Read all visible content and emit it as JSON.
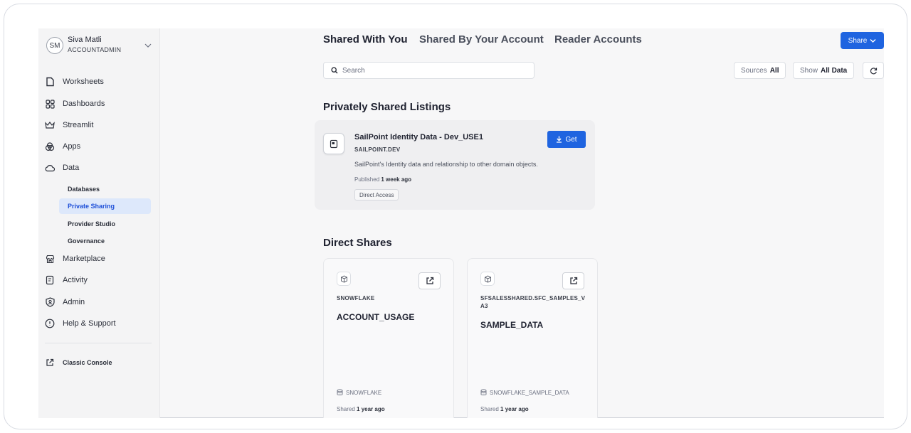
{
  "user": {
    "initials": "SM",
    "name": "Siva Matli",
    "role": "ACCOUNTADMIN"
  },
  "nav": {
    "worksheets": "Worksheets",
    "dashboards": "Dashboards",
    "streamlit": "Streamlit",
    "apps": "Apps",
    "data": "Data",
    "data_sub": [
      "Databases",
      "Private Sharing",
      "Provider Studio",
      "Governance"
    ],
    "marketplace": "Marketplace",
    "activity": "Activity",
    "admin": "Admin",
    "help": "Help & Support",
    "classic": "Classic Console"
  },
  "tabs": [
    "Shared With You",
    "Shared By Your Account",
    "Reader Accounts"
  ],
  "share_button": "Share",
  "search": {
    "placeholder": "Search"
  },
  "filters": {
    "sources_label": "Sources",
    "sources_value": "All",
    "show_label": "Show",
    "show_value": "All Data"
  },
  "sections": {
    "private": "Privately Shared Listings",
    "direct": "Direct Shares"
  },
  "listing": {
    "title": "SailPoint Identity Data - Dev_USE1",
    "provider": "SAILPOINT.DEV",
    "description": "SailPoint's Identity data and relationship to other domain objects.",
    "published_label": "Published",
    "published_value": "1 week ago",
    "badge": "Direct Access",
    "get_label": "Get"
  },
  "direct_shares": [
    {
      "provider": "SNOWFLAKE",
      "name": "ACCOUNT_USAGE",
      "database": "SNOWFLAKE",
      "shared_label": "Shared",
      "shared_value": "1 year ago"
    },
    {
      "provider": "SFSALESSHARED.SFC_SAMPLES_VA3",
      "name": "SAMPLE_DATA",
      "database": "SNOWFLAKE_SAMPLE_DATA",
      "shared_label": "Shared",
      "shared_value": "1 year ago"
    }
  ],
  "colors": {
    "accent": "#1f64e0",
    "active_nav_bg": "#dde8fb"
  }
}
